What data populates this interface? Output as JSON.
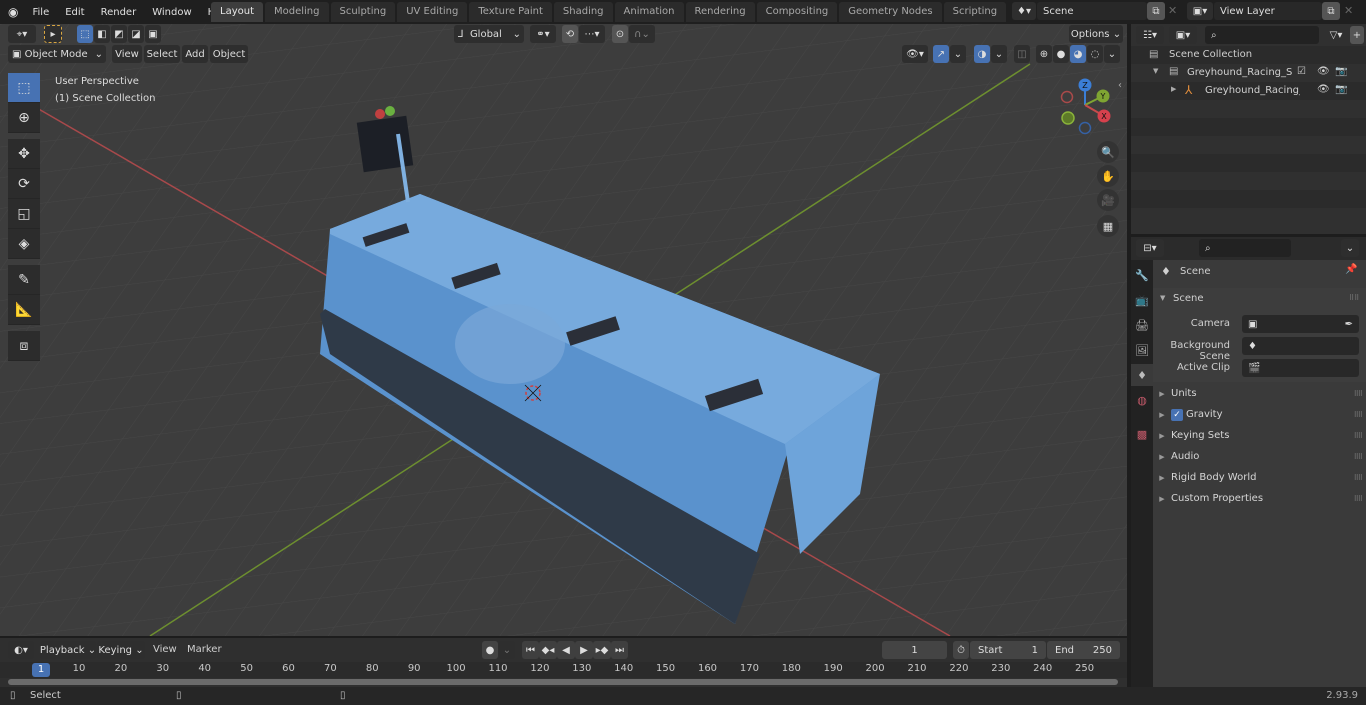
{
  "menu": {
    "items": [
      "File",
      "Edit",
      "Render",
      "Window",
      "Help"
    ]
  },
  "workspaces": {
    "tabs": [
      "Layout",
      "Modeling",
      "Sculpting",
      "UV Editing",
      "Texture Paint",
      "Shading",
      "Animation",
      "Rendering",
      "Compositing",
      "Geometry Nodes",
      "Scripting"
    ],
    "active": "Layout",
    "add_label": "+"
  },
  "scene_selector": {
    "value": "Scene"
  },
  "view_layer_selector": {
    "value": "View Layer"
  },
  "viewport_header": {
    "mode": "Object Mode",
    "menus": [
      "View",
      "Select",
      "Add",
      "Object"
    ],
    "transform_orientation": "Global",
    "options_label": "Options"
  },
  "viewport": {
    "view_name": "User Perspective",
    "collection_info": "(1) Scene Collection",
    "gizmo_axes": [
      "X",
      "Y",
      "Z"
    ],
    "object_color": "#5b96d0"
  },
  "outliner": {
    "root": "Scene Collection",
    "items": [
      {
        "label": "Greyhound_Racing_Starting_E",
        "type": "collection"
      },
      {
        "label": "Greyhound_Racing_Start",
        "type": "object"
      }
    ]
  },
  "properties": {
    "context_title": "Scene",
    "section_title": "Scene",
    "fields": [
      {
        "label": "Camera",
        "value": ""
      },
      {
        "label": "Background Scene",
        "value": ""
      },
      {
        "label": "Active Clip",
        "value": ""
      }
    ],
    "panels": [
      "Units",
      "Gravity",
      "Keying Sets",
      "Audio",
      "Rigid Body World",
      "Custom Properties"
    ],
    "gravity_checked": true
  },
  "timeline": {
    "menus": [
      "Playback",
      "Keying",
      "View",
      "Marker"
    ],
    "current_frame": "1",
    "start_label": "Start",
    "start_value": "1",
    "end_label": "End",
    "end_value": "250",
    "ruler": [
      "10",
      "20",
      "30",
      "40",
      "50",
      "60",
      "70",
      "80",
      "90",
      "100",
      "110",
      "120",
      "130",
      "140",
      "150",
      "160",
      "170",
      "180",
      "190",
      "200",
      "210",
      "220",
      "230",
      "240",
      "250"
    ],
    "playhead": "1"
  },
  "statusbar": {
    "left_label": "Select",
    "version": "2.93.9"
  },
  "colors": {
    "accent": "#4772b3",
    "axis_x": "#c64b4b",
    "axis_y": "#7fa532",
    "axis_z": "#3b7ed6"
  }
}
